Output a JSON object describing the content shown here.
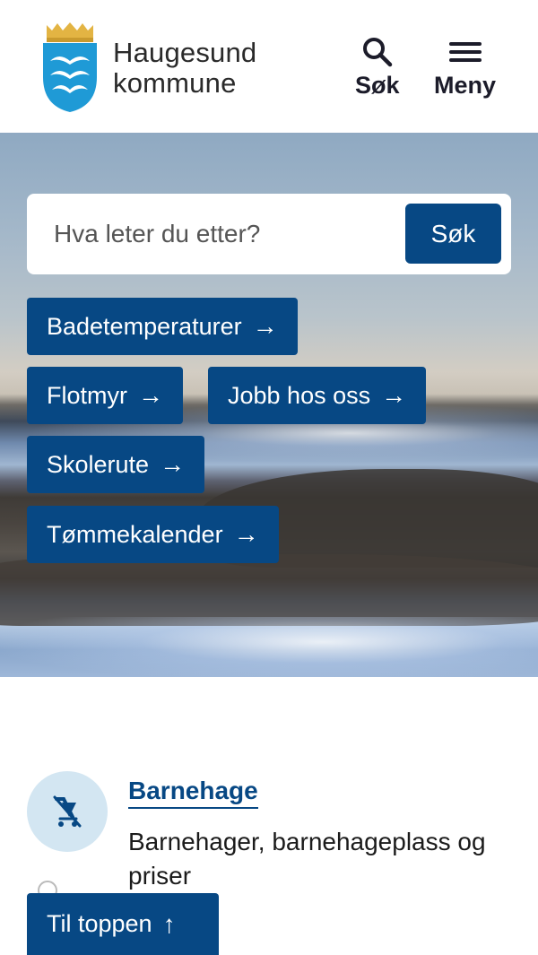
{
  "header": {
    "brand_line1": "Haugesund",
    "brand_line2": "kommune",
    "search_label": "Søk",
    "menu_label": "Meny"
  },
  "hero": {
    "search_placeholder": "Hva leter du etter?",
    "search_button": "Søk",
    "quick_links": [
      {
        "label": "Badetemperaturer",
        "icon": "arrow-right-icon"
      },
      {
        "label": "Flotmyr",
        "icon": "arrow-right-icon"
      },
      {
        "label": "Jobb hos oss",
        "icon": "arrow-right-icon"
      },
      {
        "label": "Skolerute",
        "icon": "arrow-right-icon"
      },
      {
        "label": "Tømmekalender",
        "icon": "arrow-right-icon"
      }
    ]
  },
  "services": [
    {
      "title": "Barnehage",
      "description": "Barnehager, barnehageplass og priser",
      "icon": "stroller-icon"
    }
  ],
  "to_top": {
    "label": "Til toppen",
    "icon": "arrow-up-icon"
  },
  "colors": {
    "primary": "#074884",
    "icon_bg": "#d3e6f2",
    "logo_blue": "#1f9ad6",
    "logo_gold": "#e3b443"
  }
}
